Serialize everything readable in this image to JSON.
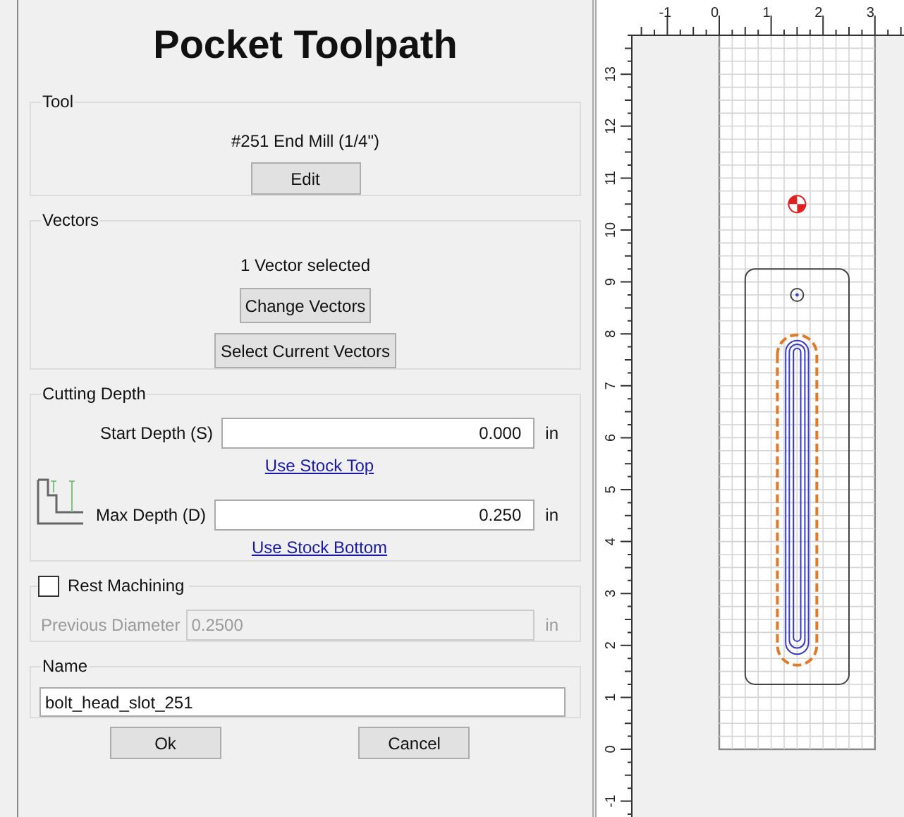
{
  "title": "Pocket Toolpath",
  "tool": {
    "legend": "Tool",
    "name": "#251 End Mill (1/4\")",
    "edit_button": "Edit"
  },
  "vectors": {
    "legend": "Vectors",
    "status": "1 Vector selected",
    "buttons": [
      "Change Vectors",
      "Select Current Vectors"
    ]
  },
  "cutting_depth": {
    "legend": "Cutting Depth",
    "fields": [
      {
        "label": "Start Depth (S)",
        "value": "0.000",
        "unit": "in",
        "link": "Use Stock Top"
      },
      {
        "label": "Max Depth (D)",
        "value": "0.250",
        "unit": "in",
        "link": "Use Stock Bottom"
      }
    ]
  },
  "rest_machining": {
    "label": "Rest Machining",
    "checked": false,
    "field": {
      "label": "Previous Diameter",
      "value": "0.2500",
      "unit": "in",
      "disabled": true
    }
  },
  "name": {
    "legend": "Name",
    "value": "bolt_head_slot_251"
  },
  "buttons": [
    "Ok",
    "Cancel"
  ],
  "view": {
    "x_ruler": [
      "-1",
      "0",
      "1",
      "2",
      "3"
    ],
    "y_ruler": [
      "13",
      "12",
      "11",
      "10",
      "9",
      "8",
      "7",
      "6",
      "5",
      "4",
      "3",
      "2",
      "1",
      "0",
      "-1"
    ]
  }
}
